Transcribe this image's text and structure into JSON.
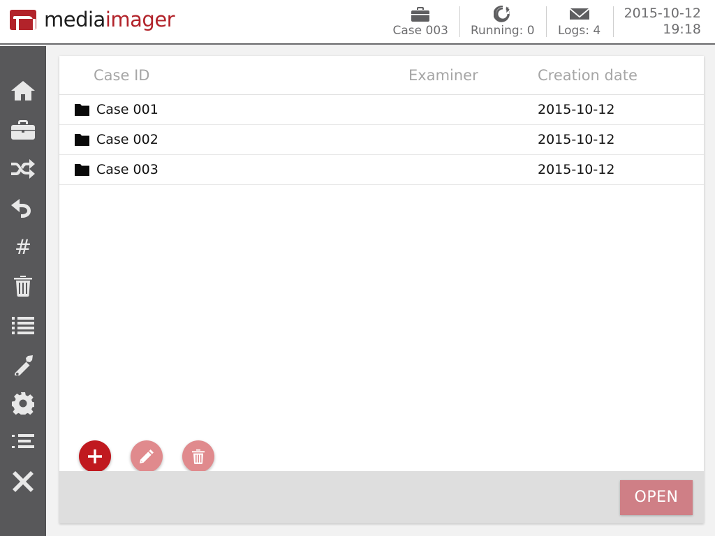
{
  "app": {
    "logo_dark_1": "media",
    "logo_red": "imager",
    "brand_red": "#b2232a",
    "sidebar_bg": "#58585a"
  },
  "header": {
    "status": [
      {
        "icon": "briefcase-icon",
        "label": "Case 003"
      },
      {
        "icon": "rotate-icon",
        "label": "Running: 0"
      },
      {
        "icon": "envelope-icon",
        "label": "Logs: 4"
      }
    ],
    "clock": {
      "date": "2015-10-12",
      "time": "19:18"
    }
  },
  "sidebar": {
    "items": [
      {
        "icon": "home-icon",
        "name": "sidebar-item-home"
      },
      {
        "icon": "briefcase-icon",
        "name": "sidebar-item-cases"
      },
      {
        "icon": "shuffle-icon",
        "name": "sidebar-item-shuffle"
      },
      {
        "icon": "undo-icon",
        "name": "sidebar-item-undo"
      },
      {
        "icon": "hash-icon",
        "name": "sidebar-item-hash"
      },
      {
        "icon": "trash-icon",
        "name": "sidebar-item-trash"
      },
      {
        "icon": "list-icon",
        "name": "sidebar-item-list"
      },
      {
        "icon": "wrench-icon",
        "name": "sidebar-item-tools"
      },
      {
        "icon": "gear-icon",
        "name": "sidebar-item-settings"
      },
      {
        "icon": "tasklist-icon",
        "name": "sidebar-item-tasks"
      },
      {
        "icon": "close-icon",
        "name": "sidebar-item-exit"
      }
    ]
  },
  "table": {
    "columns": {
      "case_id": "Case ID",
      "examiner": "Examiner",
      "creation_date": "Creation date"
    },
    "rows": [
      {
        "case_id": "Case 001",
        "examiner": "",
        "creation_date": "2015-10-12",
        "icon": "folder-icon"
      },
      {
        "case_id": "Case 002",
        "examiner": "",
        "creation_date": "2015-10-12",
        "icon": "folder-icon"
      },
      {
        "case_id": "Case 003",
        "examiner": "",
        "creation_date": "2015-10-12",
        "icon": "folder-icon"
      }
    ]
  },
  "actions": {
    "add": {
      "name": "add-case-button",
      "icon": "plus-icon",
      "enabled": true,
      "color": "#c0191f"
    },
    "edit": {
      "name": "edit-case-button",
      "icon": "pencil-icon",
      "enabled": false,
      "color": "#e08a8d"
    },
    "delete": {
      "name": "delete-case-button",
      "icon": "trash-icon",
      "enabled": false,
      "color": "#e08a8d"
    }
  },
  "footer": {
    "open_label": "OPEN",
    "open_color": "#cf7f86"
  }
}
